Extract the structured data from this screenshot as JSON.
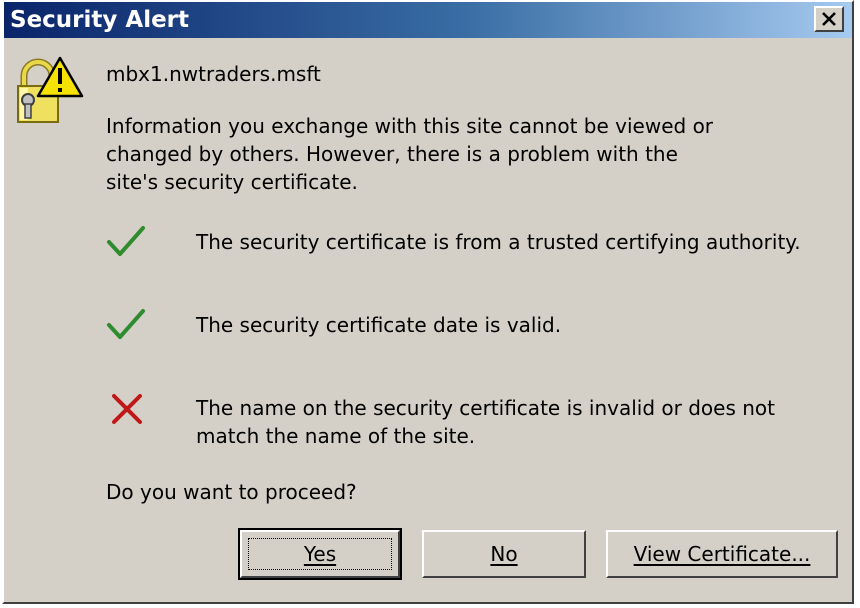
{
  "window": {
    "title": "Security Alert"
  },
  "header": {
    "site": "mbx1.nwtraders.msft"
  },
  "message": {
    "lines": [
      "Information you exchange with this site cannot be viewed or",
      "changed by others. However, there is a problem with the",
      "site's security certificate."
    ]
  },
  "checks": [
    {
      "status": "ok",
      "icon": "check-icon",
      "lines": [
        "The security certificate is from a trusted certifying authority."
      ]
    },
    {
      "status": "ok",
      "icon": "check-icon",
      "lines": [
        "The security certificate date is valid."
      ]
    },
    {
      "status": "error",
      "icon": "cross-icon",
      "lines": [
        "The name on the security certificate is invalid or does not",
        "match the name of the site."
      ]
    }
  ],
  "question": "Do you want to proceed?",
  "buttons": {
    "yes": "Yes",
    "no": "No",
    "view": "View Certificate..."
  },
  "colors": {
    "check": "#2e8b2e",
    "cross": "#c01818",
    "title_bar": "#0a246a",
    "face": "#d4d0c8"
  }
}
